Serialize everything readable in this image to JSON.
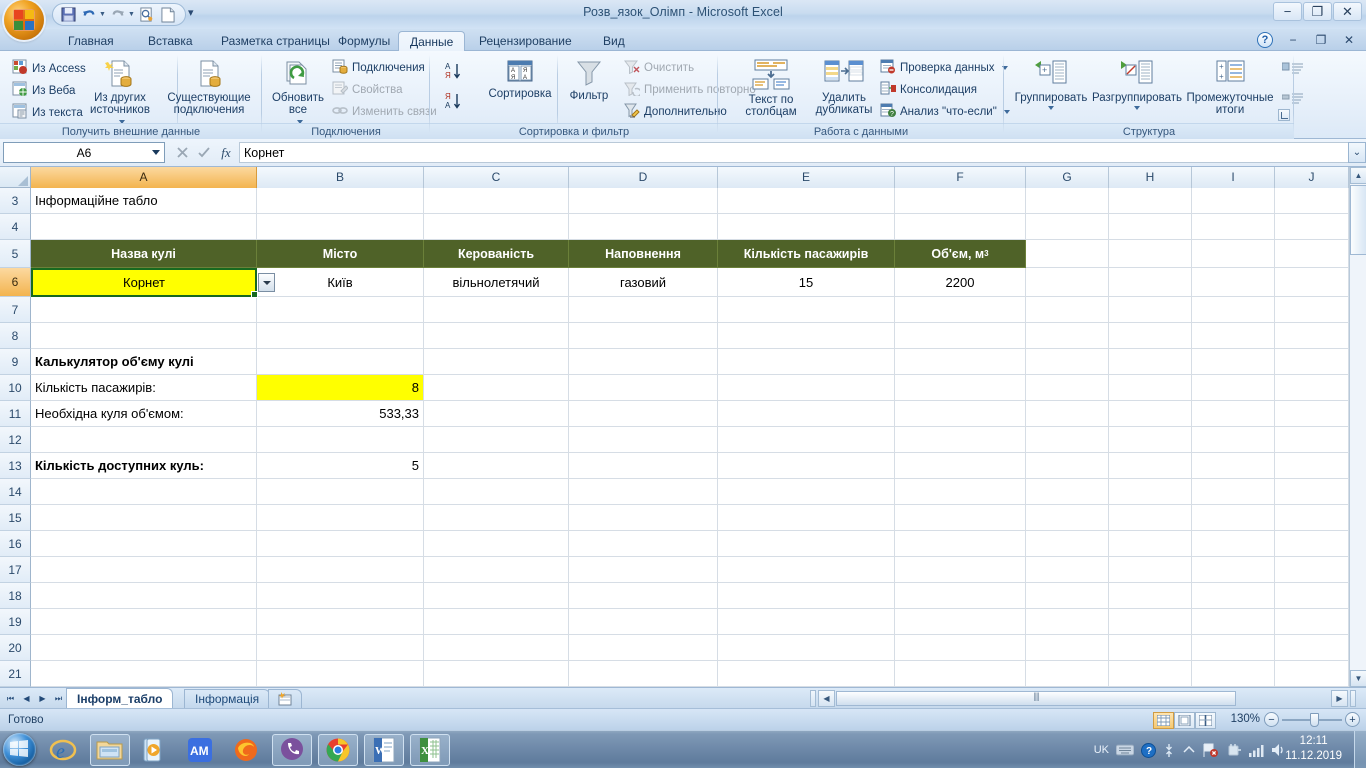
{
  "window": {
    "title": "Розв_язок_Олімп - Microsoft Excel",
    "minimize": "−",
    "restore": "❐",
    "close": "✕"
  },
  "quick_access": {
    "items": [
      "save-icon",
      "undo-icon",
      "redo-icon",
      "print-preview-icon",
      "new-icon"
    ],
    "more": "▾"
  },
  "ribbon": {
    "tabs": [
      {
        "label": "Главная",
        "active": false
      },
      {
        "label": "Вставка",
        "active": false
      },
      {
        "label": "Разметка страницы",
        "active": false
      },
      {
        "label": "Формулы",
        "active": false
      },
      {
        "label": "Данные",
        "active": true
      },
      {
        "label": "Рецензирование",
        "active": false
      },
      {
        "label": "Вид",
        "active": false
      }
    ],
    "groups": [
      {
        "name": "Получить внешние данные",
        "small_items": [
          "Из Access",
          "Из Веба",
          "Из текста"
        ],
        "big_items": [
          "Из других источников",
          "Существующие подключения"
        ]
      },
      {
        "name": "Подключения",
        "small_items": [
          "Подключения",
          "Свойства",
          "Изменить связи"
        ],
        "big_items": [
          "Обновить все"
        ]
      },
      {
        "name": "Сортировка и фильтр",
        "small_items": [
          "Очистить",
          "Применить повторно",
          "Дополнительно"
        ],
        "big_items": [
          "Сортировка",
          "Фильтр"
        ]
      },
      {
        "name": "Работа с данными",
        "small_items": [
          "Проверка данных",
          "Консолидация",
          "Анализ \"что-если\""
        ],
        "big_items": [
          "Текст по столбцам",
          "Удалить дубликаты"
        ]
      },
      {
        "name": "Структура",
        "small_items": [],
        "big_items": [
          "Группировать",
          "Разгруппировать",
          "Промежуточные итоги"
        ]
      }
    ]
  },
  "formula_bar": {
    "name_box": "A6",
    "formula": "Корнет",
    "fx_label": "fx"
  },
  "grid": {
    "columns": [
      "A",
      "B",
      "C",
      "D",
      "E",
      "F",
      "G",
      "H",
      "I",
      "J"
    ],
    "selected_column": "A",
    "selected_row": "6",
    "rows": [
      "3",
      "4",
      "5",
      "6",
      "7",
      "8",
      "9",
      "10",
      "11",
      "12",
      "13",
      "14",
      "15",
      "16",
      "17",
      "18",
      "19",
      "20",
      "21"
    ],
    "cells": {
      "A3": "Інформаційне табло",
      "A5": "Назва кулі",
      "B5": "Місто",
      "C5": "Керованість",
      "D5": "Наповнення",
      "E5": "Кількість пасажирів",
      "F5_base": "Об'єм, м",
      "F5_sup": "3",
      "A6": "Корнет",
      "B6": "Київ",
      "C6": "вільнолетячий",
      "D6": "газовий",
      "E6": "15",
      "F6": "2200",
      "A9": "Калькулятор об'єму кулі",
      "A10": "Кількість пасажирів:",
      "B10": "8",
      "A11": "Необхідна куля об'ємом:",
      "B11": "533,33",
      "A13": "Кількість доступних куль:",
      "B13": "5"
    },
    "header_fill": "#4f6228",
    "highlight_fill": "#ffff00"
  },
  "sheet_tabs": {
    "nav": [
      "⏮",
      "◀",
      "▶",
      "⏭"
    ],
    "tabs": [
      {
        "label": "Інформ_табло",
        "active": true
      },
      {
        "label": "Інформація",
        "active": false
      }
    ],
    "new_sheet_icon": "new-sheet-icon"
  },
  "status_bar": {
    "text": "Готово",
    "views": [
      "normal-view-icon",
      "page-layout-icon",
      "page-break-icon"
    ],
    "zoom": "130%",
    "zoom_out": "−",
    "zoom_in": "+"
  },
  "taskbar": {
    "start": "start-orb",
    "apps": [
      "internet-explorer-icon",
      "explorer-icon",
      "media-player-icon",
      "am-icon",
      "firefox-icon",
      "viber-icon",
      "chrome-icon",
      "word-icon",
      "excel-icon"
    ],
    "tray": [
      "UK",
      "keyboard-icon",
      "help-icon",
      "network-arrows-icon",
      "show-hidden-icon",
      "flag-icon",
      "plug-icon",
      "signal-icon",
      "volume-icon"
    ],
    "clock_time": "12:11",
    "clock_date": "11.12.2019"
  }
}
